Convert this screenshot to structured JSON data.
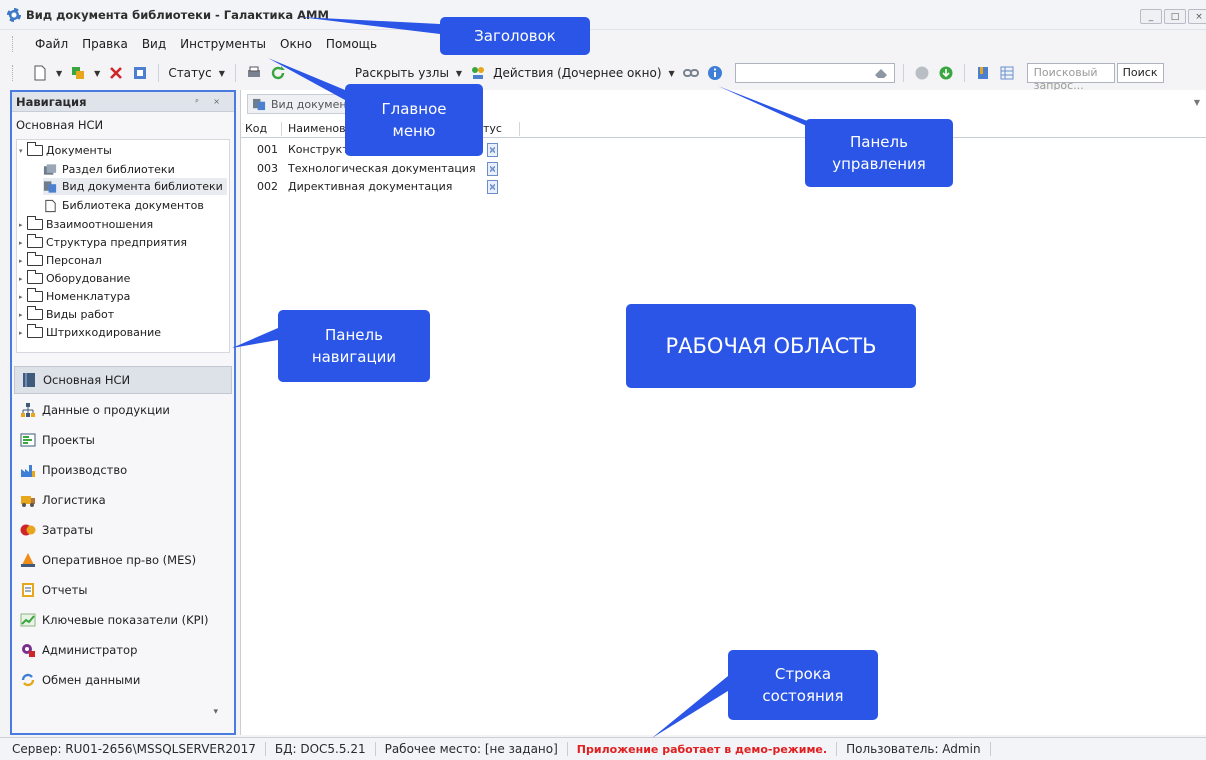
{
  "window": {
    "title": "Вид документа библиотеки - Галактика AMM",
    "controls": [
      "_",
      "□",
      "×"
    ]
  },
  "menu": [
    "Файл",
    "Правка",
    "Вид",
    "Инструменты",
    "Окно",
    "Помощь"
  ],
  "toolbar": {
    "status_label": "Статус",
    "expand_label": "Раскрыть узлы",
    "actions_label": "Действия (Дочернее окно)",
    "search_placeholder": "Поисковый запрос...",
    "search_button": "Поиск"
  },
  "nav": {
    "header": "Навигация",
    "header_controls": "ᵖ ×",
    "section": "Основная НСИ",
    "tree": [
      {
        "label": "Документы",
        "level": 0,
        "expanded": true,
        "icon": "folder-icon"
      },
      {
        "label": "Раздел библиотеки",
        "level": 1,
        "icon": "books-icon"
      },
      {
        "label": "Вид документа библиотеки",
        "level": 1,
        "icon": "doc-type-icon",
        "selected": true
      },
      {
        "label": "Библиотека документов",
        "level": 1,
        "icon": "document-icon"
      },
      {
        "label": "Взаимоотношения",
        "level": 0,
        "icon": "folder-icon"
      },
      {
        "label": "Структура предприятия",
        "level": 0,
        "icon": "folder-icon"
      },
      {
        "label": "Персонал",
        "level": 0,
        "icon": "folder-icon"
      },
      {
        "label": "Оборудование",
        "level": 0,
        "icon": "folder-icon"
      },
      {
        "label": "Номенклатура",
        "level": 0,
        "icon": "folder-icon"
      },
      {
        "label": "Виды работ",
        "level": 0,
        "icon": "folder-icon"
      },
      {
        "label": "Штрихкодирование",
        "level": 0,
        "icon": "folder-icon"
      }
    ],
    "buttons": [
      {
        "label": "Основная НСИ",
        "icon": "book-icon",
        "active": true
      },
      {
        "label": "Данные о продукции",
        "icon": "hierarchy-icon"
      },
      {
        "label": "Проекты",
        "icon": "projects-icon"
      },
      {
        "label": "Производство",
        "icon": "factory-icon"
      },
      {
        "label": "Логистика",
        "icon": "truck-icon"
      },
      {
        "label": "Затраты",
        "icon": "costs-icon"
      },
      {
        "label": "Оперативное пр-во (MES)",
        "icon": "mes-icon"
      },
      {
        "label": "Отчеты",
        "icon": "reports-icon"
      },
      {
        "label": "Ключевые показатели (KPI)",
        "icon": "kpi-chart-icon"
      },
      {
        "label": "Администратор",
        "icon": "admin-gear-icon"
      },
      {
        "label": "Обмен данными",
        "icon": "exchange-icon"
      }
    ]
  },
  "work": {
    "tab": "Вид докумен",
    "columns": [
      "Код",
      "Наименов",
      "тус"
    ],
    "rows": [
      {
        "code": "001",
        "name": "Конструкт"
      },
      {
        "code": "003",
        "name": "Технологическая документация"
      },
      {
        "code": "002",
        "name": "Директивная документация"
      }
    ]
  },
  "statusbar": {
    "server": "Сервер: RU01-2656\\MSSQLSERVER2017",
    "db": "БД: DOC5.5.21",
    "workplace": "Рабочее место: [не задано]",
    "demo": "Приложение работает в демо-режиме.",
    "user": "Пользователь: Admin"
  },
  "callouts": {
    "title": "Заголовок",
    "main_menu": "Главное меню",
    "control_panel": "Панель управления",
    "nav_panel": "Панель навигации",
    "work_area": "РАБОЧАЯ ОБЛАСТЬ",
    "status_line": "Строка состояния"
  },
  "colors": {
    "callout": "#2a55e6",
    "nav_border": "#4a7be0",
    "demo_text": "#e02020"
  }
}
